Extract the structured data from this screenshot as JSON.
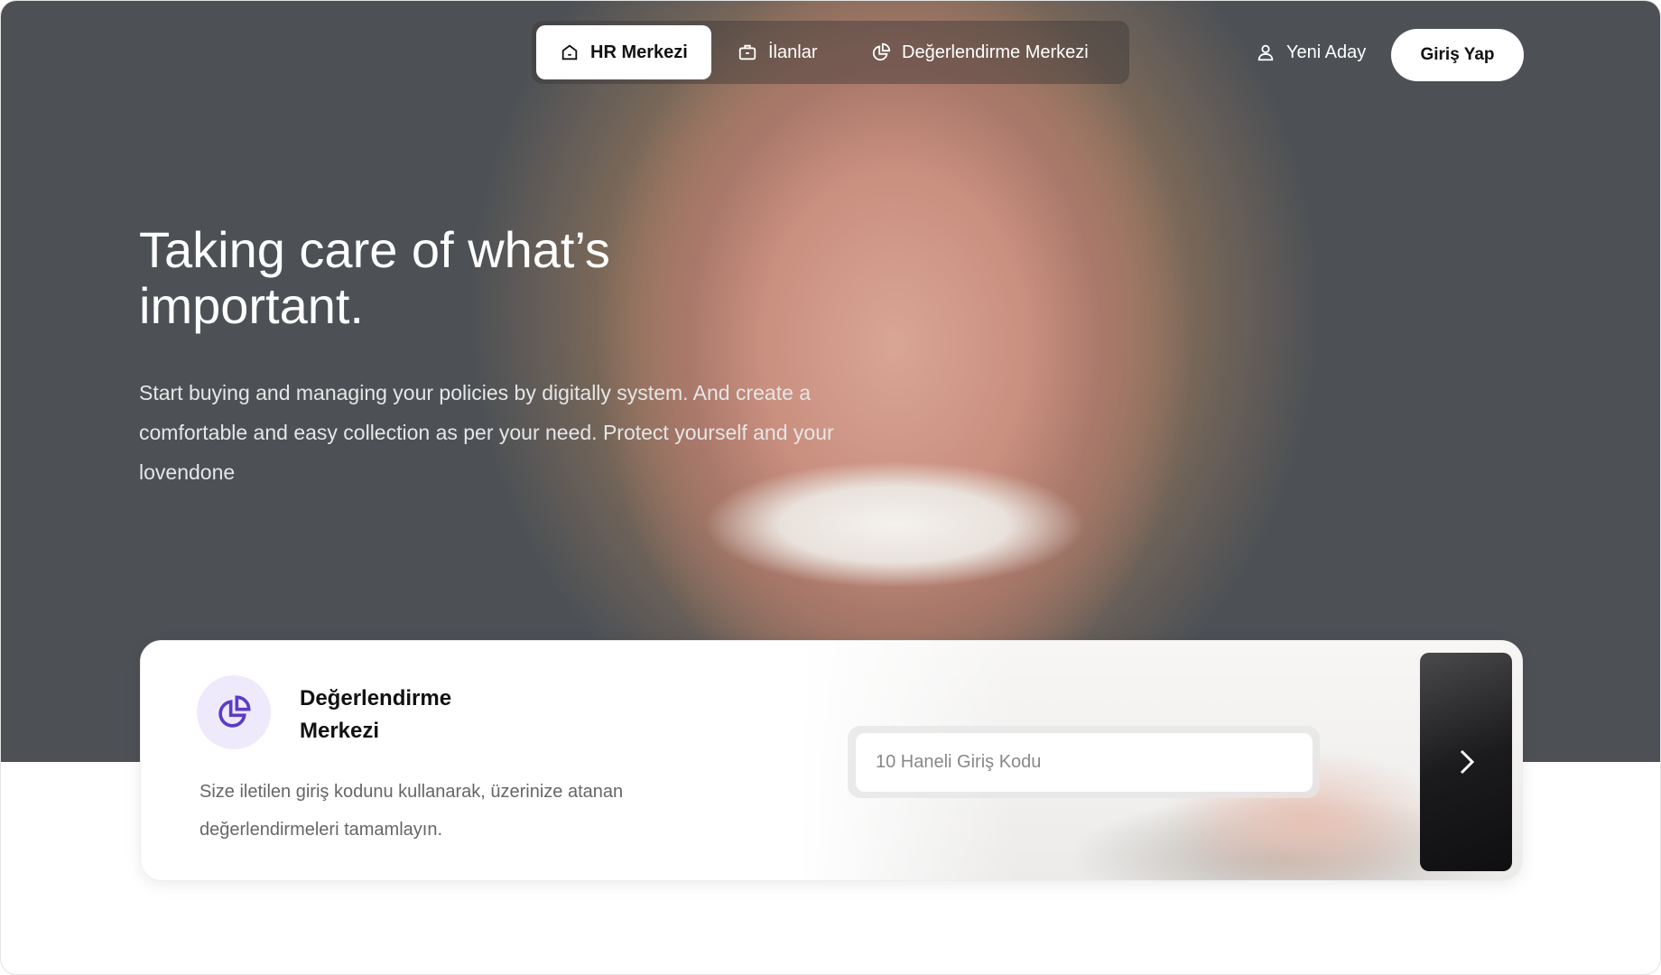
{
  "nav": {
    "items": [
      {
        "label": "HR Merkezi",
        "icon": "home-icon",
        "active": true
      },
      {
        "label": "İlanlar",
        "icon": "briefcase-icon"
      },
      {
        "label": "Değerlendirme Merkezi",
        "icon": "pie-chart-icon"
      }
    ],
    "new_candidate": "Yeni Aday",
    "login": "Giriş Yap"
  },
  "hero": {
    "title": "Taking care of what’s important.",
    "text": "Start buying and managing your policies by digitally system. And create a comfortable and easy collection as per your need. Protect yourself and your lovendone"
  },
  "card": {
    "title": "Değerlendirme Merkezi",
    "description": "Size iletilen giriş kodunu kullanarak, üzerinize atanan değerlendirmeleri tamamlayın.",
    "input_placeholder": "10 Haneli Giriş Kodu",
    "icon": "pie-chart-icon",
    "accent": "#5b3cc4"
  }
}
